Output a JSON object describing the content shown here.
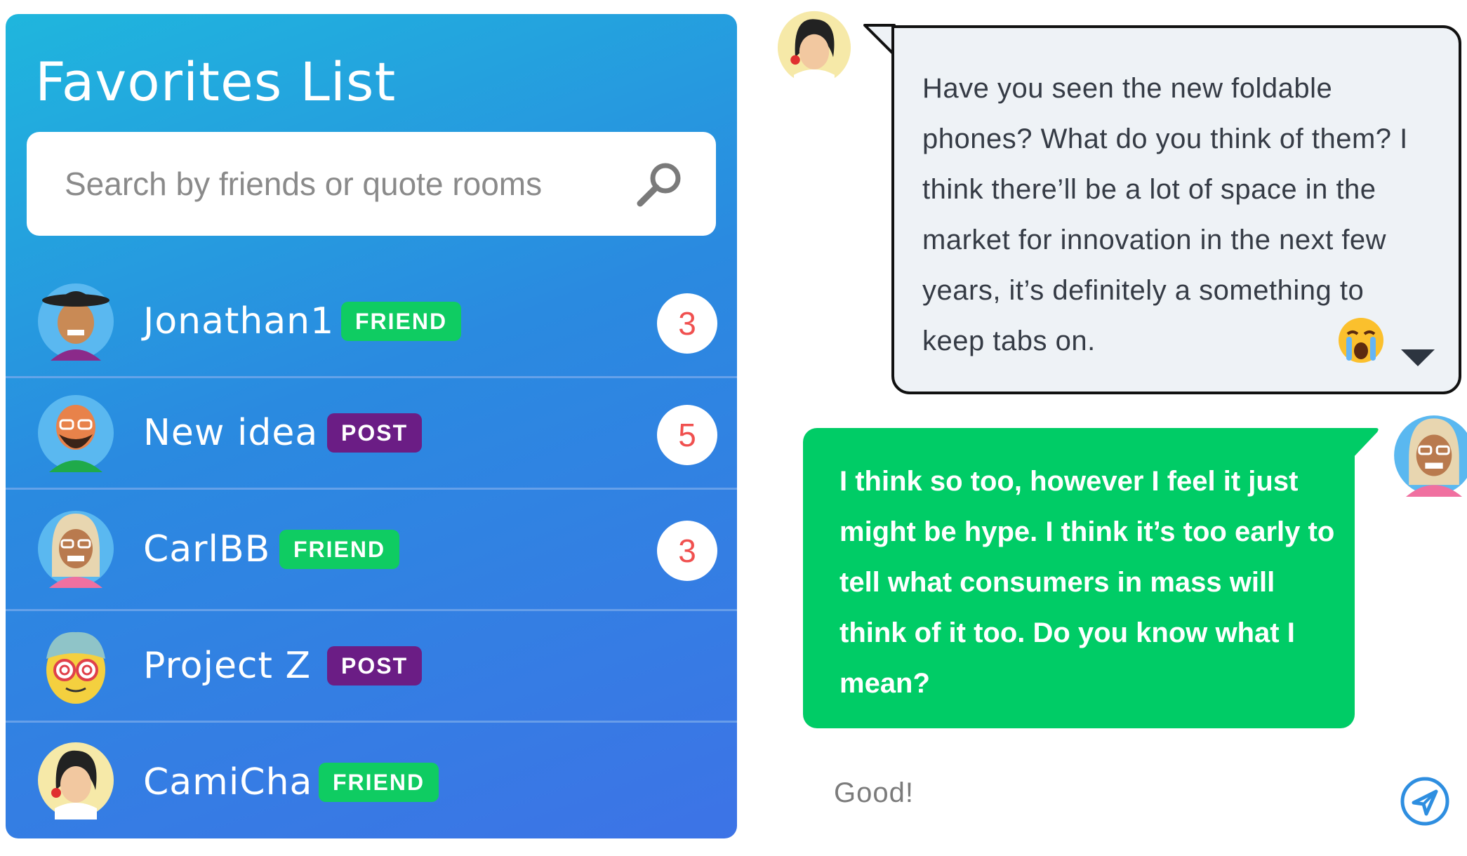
{
  "favorites": {
    "title": "Favorites List",
    "search_placeholder": "Search by friends or quote rooms",
    "items": [
      {
        "name": "Jonathan1",
        "tag": "FRIEND",
        "count": "3"
      },
      {
        "name": "New idea",
        "tag": "POST",
        "count": "5"
      },
      {
        "name": "CarlBB",
        "tag": "FRIEND",
        "count": "3"
      },
      {
        "name": "Project Z",
        "tag": "POST",
        "count": ""
      },
      {
        "name": "CamiCha",
        "tag": "FRIEND",
        "count": ""
      }
    ]
  },
  "chat": {
    "incoming": {
      "text": "Have you seen the new foldable phones? What do you think of them? I think there’ll be a lot of space in the market for innovation in the next few years, it’s definitely a something to keep tabs on.",
      "reaction_icon": "crying-face-icon"
    },
    "outgoing": {
      "text": "I think so too, however I feel it just might be hype. I think it’s too early to tell what consumers in mass will think of it too. Do you know what I mean?"
    },
    "reply_value": "Good!"
  },
  "colors": {
    "friend_tag": "#0fcc62",
    "post_tag": "#6b1d85",
    "outgoing_bubble": "#00cc66",
    "count_text": "#f0504f",
    "send_icon": "#2e8ee0"
  }
}
